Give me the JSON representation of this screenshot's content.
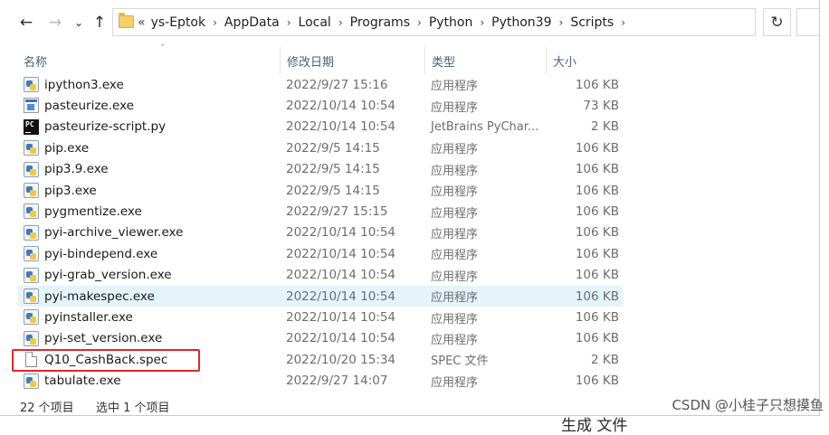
{
  "nav": {
    "back_icon": "arrow-left-icon",
    "forward_icon": "arrow-right-icon",
    "recent_icon": "chevron-down-icon",
    "up_icon": "arrow-up-icon",
    "overflow": "«",
    "breadcrumbs": [
      "ys-Eptok",
      "AppData",
      "Local",
      "Programs",
      "Python",
      "Python39",
      "Scripts"
    ],
    "dropdown_icon": "chevron-down-icon",
    "refresh_glyph": "↻"
  },
  "columns": {
    "name": "名称",
    "date": "修改日期",
    "type": "类型",
    "size": "大小"
  },
  "files": [
    {
      "name": "ipython3.exe",
      "date": "2022/9/27 15:16",
      "type": "应用程序",
      "size": "106 KB",
      "icon": "python-exe-icon"
    },
    {
      "name": "pasteurize.exe",
      "date": "2022/10/14 10:54",
      "type": "应用程序",
      "size": "73 KB",
      "icon": "window-exe-icon"
    },
    {
      "name": "pasteurize-script.py",
      "date": "2022/10/14 10:54",
      "type": "JetBrains PyChar...",
      "size": "2 KB",
      "icon": "pycharm-icon"
    },
    {
      "name": "pip.exe",
      "date": "2022/9/5 14:15",
      "type": "应用程序",
      "size": "106 KB",
      "icon": "python-exe-icon"
    },
    {
      "name": "pip3.9.exe",
      "date": "2022/9/5 14:15",
      "type": "应用程序",
      "size": "106 KB",
      "icon": "python-exe-icon"
    },
    {
      "name": "pip3.exe",
      "date": "2022/9/5 14:15",
      "type": "应用程序",
      "size": "106 KB",
      "icon": "python-exe-icon"
    },
    {
      "name": "pygmentize.exe",
      "date": "2022/9/27 15:15",
      "type": "应用程序",
      "size": "106 KB",
      "icon": "python-exe-icon"
    },
    {
      "name": "pyi-archive_viewer.exe",
      "date": "2022/10/14 10:54",
      "type": "应用程序",
      "size": "106 KB",
      "icon": "python-exe-icon"
    },
    {
      "name": "pyi-bindepend.exe",
      "date": "2022/10/14 10:54",
      "type": "应用程序",
      "size": "106 KB",
      "icon": "python-exe-icon"
    },
    {
      "name": "pyi-grab_version.exe",
      "date": "2022/10/14 10:54",
      "type": "应用程序",
      "size": "106 KB",
      "icon": "python-exe-icon"
    },
    {
      "name": "pyi-makespec.exe",
      "date": "2022/10/14 10:54",
      "type": "应用程序",
      "size": "106 KB",
      "icon": "python-exe-icon",
      "selected": true
    },
    {
      "name": "pyinstaller.exe",
      "date": "2022/10/14 10:54",
      "type": "应用程序",
      "size": "106 KB",
      "icon": "python-exe-icon"
    },
    {
      "name": "pyi-set_version.exe",
      "date": "2022/10/14 10:54",
      "type": "应用程序",
      "size": "106 KB",
      "icon": "python-exe-icon"
    },
    {
      "name": "Q10_CashBack.spec",
      "date": "2022/10/20 15:34",
      "type": "SPEC 文件",
      "size": "2 KB",
      "icon": "file-icon",
      "highlighted": true
    },
    {
      "name": "tabulate.exe",
      "date": "2022/9/27 14:07",
      "type": "应用程序",
      "size": "106 KB",
      "icon": "python-exe-icon"
    }
  ],
  "status": {
    "item_count": "22 个项目",
    "selection": "选中 1 个项目"
  },
  "overlay": {
    "watermark": "CSDN @小桂子只想摸鱼",
    "cropped_text": "生成      文件"
  },
  "colors": {
    "highlight_border": "#e0282c",
    "selected_row": "#e5f3fb",
    "header_text": "#4c607a"
  }
}
